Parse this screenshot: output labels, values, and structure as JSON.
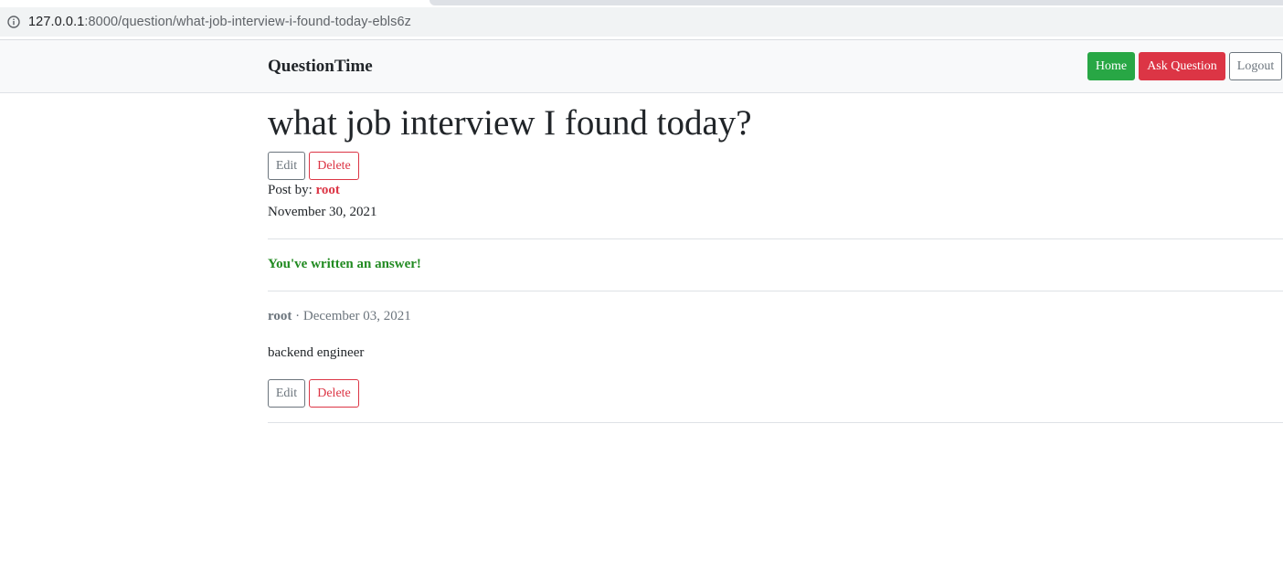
{
  "browser": {
    "url_host": "127.0.0.1",
    "url_rest": ":8000/question/what-job-interview-i-found-today-ebls6z",
    "info_icon": "info-circle-icon"
  },
  "navbar": {
    "brand": "QuestionTime",
    "home_label": "Home",
    "ask_label": "Ask Question",
    "logout_label": "Logout"
  },
  "question": {
    "title": "what job interview I found today?",
    "edit_label": "Edit",
    "delete_label": "Delete",
    "post_by_label": "Post by:",
    "author": "root",
    "date": "November 30, 2021"
  },
  "notice": "You've written an answer!",
  "answer": {
    "author": "root",
    "separator": "·",
    "date": "December 03, 2021",
    "body": "backend engineer",
    "edit_label": "Edit",
    "delete_label": "Delete"
  },
  "colors": {
    "success": "#28a745",
    "danger": "#dc3545",
    "secondary": "#6c757d",
    "notice": "#228b22",
    "navbar_bg": "#f8f9fa"
  }
}
